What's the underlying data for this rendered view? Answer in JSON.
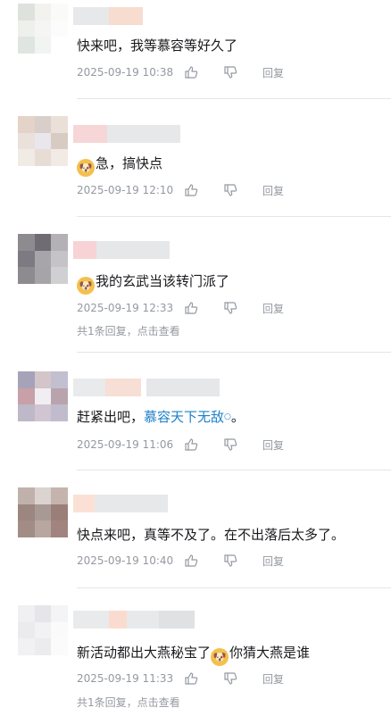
{
  "comments": [
    {
      "text": "快来吧，我等慕容等好久了",
      "time": "2025-09-19 10:38",
      "reply_label": "回复",
      "replies_label": ""
    },
    {
      "emoji": "doge-emoji",
      "text": "急，搞快点",
      "time": "2025-09-19 12:10",
      "reply_label": "回复",
      "replies_label": ""
    },
    {
      "emoji": "doge-emoji",
      "text": "我的玄武当该转门派了",
      "time": "2025-09-19 12:33",
      "reply_label": "回复",
      "replies_label": "共1条回复，点击查看"
    },
    {
      "text_before": "赶紧出吧，",
      "link": "慕容天下无敌",
      "text_after": "。",
      "time": "2025-09-19 11:06",
      "reply_label": "回复",
      "replies_label": ""
    },
    {
      "text": "快点来吧，真等不及了。在不出落后太多了。",
      "time": "2025-09-19 10:40",
      "reply_label": "回复",
      "replies_label": ""
    },
    {
      "text_before": "新活动都出大燕秘宝了",
      "emoji": "doge-emoji",
      "text_after": "你猜大燕是谁",
      "time": "2025-09-19 11:33",
      "reply_label": "回复",
      "replies_label": "共1条回复，点击查看"
    }
  ],
  "icons": {
    "like": "thumbs-up-icon",
    "dislike": "thumbs-down-icon"
  },
  "colors": {
    "link": "#1e80c9",
    "meta": "#9499a0",
    "divider": "#e3e5e7"
  }
}
